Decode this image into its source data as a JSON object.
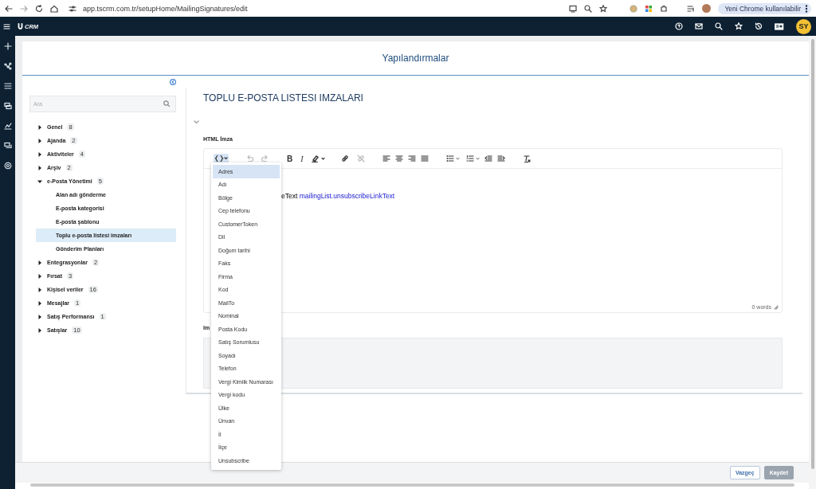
{
  "browser": {
    "url": "app.tscrm.com.tr/setupHome/MailingSignatures/edit",
    "update_button": "Yeni Chrome kullanılabilir"
  },
  "app_bar": {
    "logo_text": "CRM",
    "avatar": "SY"
  },
  "page_title": "Yapılandırmalar",
  "sidebar": {
    "search_placeholder": "Ara",
    "tree": [
      {
        "label": "Genel",
        "count": "8",
        "expanded": false
      },
      {
        "label": "Ajanda",
        "count": "2",
        "expanded": false
      },
      {
        "label": "Aktiviteler",
        "count": "4",
        "expanded": false
      },
      {
        "label": "Arşiv",
        "count": "2",
        "expanded": false
      },
      {
        "label": "e-Posta Yönetimi",
        "count": "5",
        "expanded": true,
        "children": [
          {
            "label": "Alan adı gönderme",
            "selected": false
          },
          {
            "label": "E-posta kategorisi",
            "selected": false
          },
          {
            "label": "E-posta şablonu",
            "selected": false
          },
          {
            "label": "Toplu e-posta listesi imzaları",
            "selected": true
          },
          {
            "label": "Gönderim Planları",
            "selected": false
          }
        ]
      },
      {
        "label": "Entegrasyonlar",
        "count": "2",
        "expanded": false
      },
      {
        "label": "Fırsat",
        "count": "3",
        "expanded": false
      },
      {
        "label": "Kişisel veriler",
        "count": "16",
        "expanded": false
      },
      {
        "label": "Mesajlar",
        "count": "1",
        "expanded": false
      },
      {
        "label": "Satış Performansı",
        "count": "1",
        "expanded": false
      },
      {
        "label": "Satışlar",
        "count": "10",
        "expanded": false
      }
    ]
  },
  "content": {
    "title": "TOPLU E-POSTA LISTESI IMZALARI",
    "html_field": {
      "label": "HTML İmza",
      "toolbar": [
        {
          "kind": "variables",
          "selected": true
        },
        {
          "kind": "undo",
          "disabled": true
        },
        {
          "kind": "redo",
          "disabled": true
        },
        {
          "kind": "bold",
          "label": "B"
        },
        {
          "kind": "italic",
          "label": "I"
        },
        {
          "kind": "highlight"
        },
        {
          "kind": "link"
        },
        {
          "kind": "unlink",
          "disabled": true
        },
        {
          "kind": "align-left"
        },
        {
          "kind": "align-center"
        },
        {
          "kind": "align-right"
        },
        {
          "kind": "justify"
        },
        {
          "kind": "bullets"
        },
        {
          "kind": "numbers"
        },
        {
          "kind": "outdent"
        },
        {
          "kind": "indent"
        },
        {
          "kind": "clear-format"
        }
      ],
      "body_text": "eText",
      "body_link": "mailingList.unsubscribeLinkText",
      "status": "0 words"
    },
    "variable_menu": [
      {
        "label": "Adres",
        "selected": true
      },
      {
        "label": "Adı",
        "selected": false
      },
      {
        "label": "Bölge",
        "selected": false
      },
      {
        "label": "Cep telefonu",
        "selected": false
      },
      {
        "label": "CustomerToken",
        "selected": false
      },
      {
        "label": "Dil",
        "selected": false
      },
      {
        "label": "Doğum tarihi",
        "selected": false
      },
      {
        "label": "Faks",
        "selected": false
      },
      {
        "label": "Firma",
        "selected": false
      },
      {
        "label": "Kod",
        "selected": false
      },
      {
        "label": "MailTo",
        "selected": false
      },
      {
        "label": "Nominal",
        "selected": false
      },
      {
        "label": "Posta Kodu",
        "selected": false
      },
      {
        "label": "Satış Sorumlusu",
        "selected": false
      },
      {
        "label": "Soyadı",
        "selected": false
      },
      {
        "label": "Telefon",
        "selected": false
      },
      {
        "label": "Vergi Kimlik Numarası",
        "selected": false
      },
      {
        "label": "Vergi kodu",
        "selected": false
      },
      {
        "label": "Ülke",
        "selected": false
      },
      {
        "label": "Ünvan",
        "selected": false
      },
      {
        "label": "İl",
        "selected": false
      },
      {
        "label": "İlçe",
        "selected": false
      },
      {
        "label": "Unsubscribe",
        "selected": false
      }
    ],
    "second_field": {
      "label": "Im"
    }
  },
  "footer": {
    "buttons": [
      {
        "label": "Vazgeç",
        "disabled": false
      },
      {
        "label": "Kaydet",
        "disabled": true
      }
    ]
  }
}
